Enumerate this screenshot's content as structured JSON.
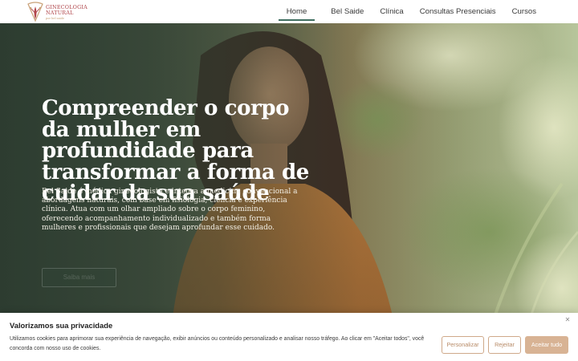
{
  "brand": {
    "name_line1": "GINECOLOGIA",
    "name_line2": "NATURAL",
    "tagline": "por bel saide",
    "colors": {
      "primary": "#b0454a",
      "accent": "#c9a178",
      "nav_active": "#3f6e60"
    }
  },
  "nav": {
    "items": [
      {
        "label": "Home",
        "active": true
      },
      {
        "label": "Bel Saide",
        "active": false
      },
      {
        "label": "Clínica",
        "active": false
      },
      {
        "label": "Consultas Presenciais",
        "active": false
      },
      {
        "label": "Cursos",
        "active": false
      }
    ]
  },
  "hero": {
    "title": "Compreender o corpo da mulher em profundidade para transformar a forma de cuidar da sua saúde",
    "text": "Bel Saide é médica ginecologista e integra a medicina convencional a abordagens naturais, com base em fisiologia, ciência e experiência clínica. Atua com um olhar ampliado sobre o corpo feminino, oferecendo acompanhamento individualizado e também forma mulheres e profissionais que desejam aprofundar esse cuidado.",
    "cta_label": "Saiba mais",
    "colors": {
      "overlay": "#28382c",
      "title": "#ffffff"
    }
  },
  "cookie_banner": {
    "title": "Valorizamos sua privacidade",
    "text": "Utilizamos cookies para aprimorar sua experiência de navegação, exibir anúncios ou conteúdo personalizado e analisar nosso tráfego. Ao clicar em \"Aceitar todos\", você concorda com nosso uso de cookies.",
    "close_icon": "close-icon",
    "buttons": {
      "customize": "Personalizar",
      "reject": "Rejeitar",
      "accept": "Aceitar tudo"
    },
    "colors": {
      "button_border": "#cfa98a",
      "accept_bg": "#d8b394"
    }
  }
}
